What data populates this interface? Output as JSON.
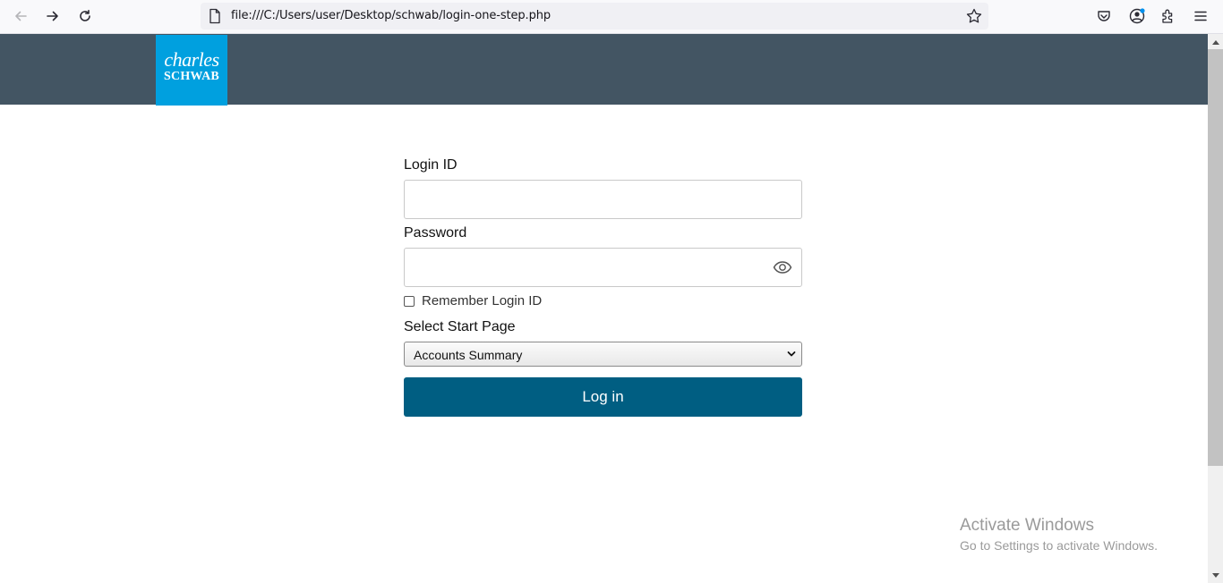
{
  "browser": {
    "url": "file:///C:/Users/user/Desktop/schwab/login-one-step.php"
  },
  "logo": {
    "line1": "charles",
    "line2": "SCHWAB"
  },
  "form": {
    "login_id_label": "Login ID",
    "login_id_value": "",
    "password_label": "Password",
    "password_value": "",
    "remember_label": "Remember Login ID",
    "remember_checked": false,
    "start_page_label": "Select Start Page",
    "start_page_value": "Accounts Summary",
    "login_button": "Log in"
  },
  "watermark": {
    "title": "Activate Windows",
    "subtitle": "Go to Settings to activate Windows."
  },
  "colors": {
    "header": "#435563",
    "logo": "#00a0df",
    "button": "#005e82"
  }
}
